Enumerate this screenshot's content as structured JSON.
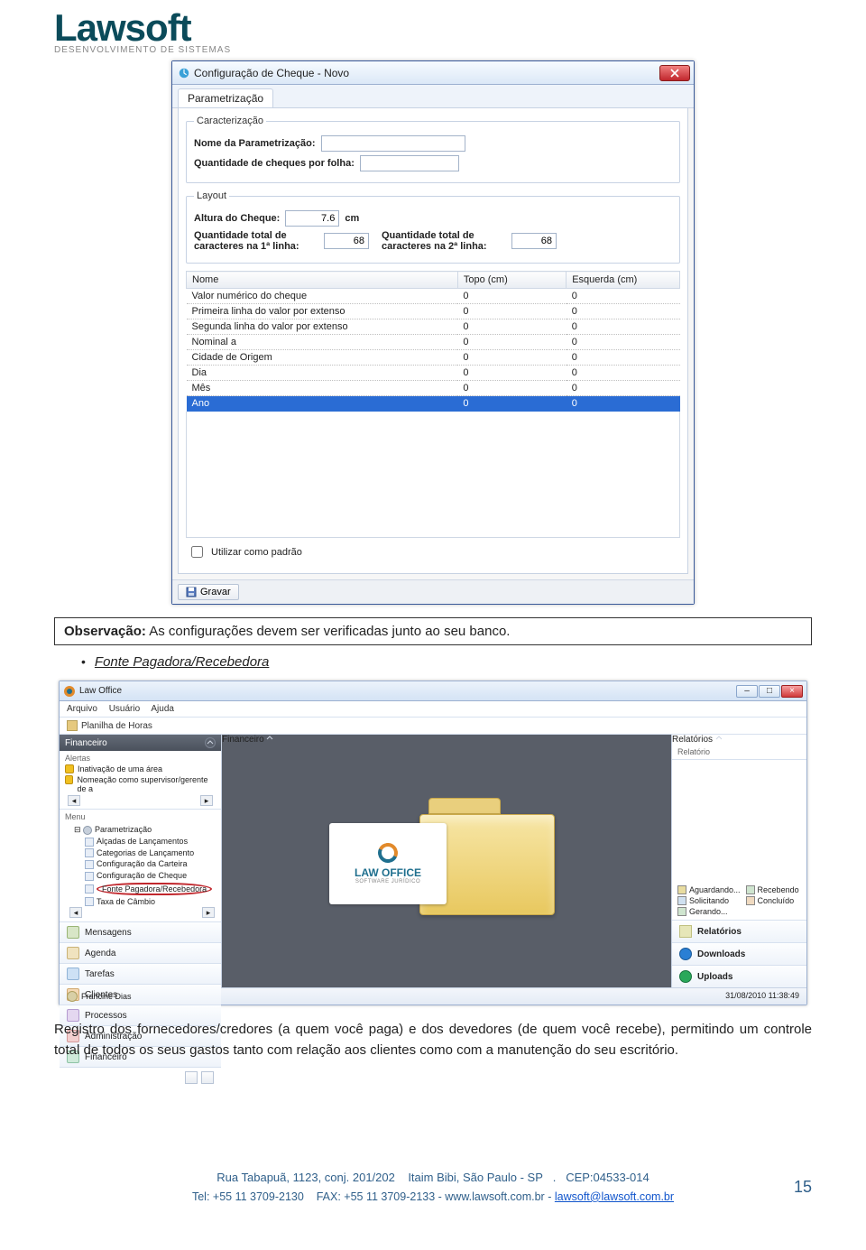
{
  "brand": {
    "name": "Lawsoft",
    "tagline": "DESENVOLVIMENTO DE SISTEMAS"
  },
  "cheque_window": {
    "title": "Configuração de Cheque - Novo",
    "tab": "Parametrização",
    "group1": {
      "legend": "Caracterização",
      "nome_label": "Nome da Parametrização:",
      "nome_value": "",
      "qtd_folha_label": "Quantidade de cheques por folha:",
      "qtd_folha_value": ""
    },
    "group2": {
      "legend": "Layout",
      "altura_label": "Altura do Cheque:",
      "altura_value": "7.6",
      "altura_unit": "cm",
      "qtd1_label": "Quantidade total de caracteres na 1ª linha:",
      "qtd1_value": "68",
      "qtd2_label": "Quantidade total de caracteres na 2ª linha:",
      "qtd2_value": "68"
    },
    "table": {
      "cols": [
        "Nome",
        "Topo (cm)",
        "Esquerda (cm)"
      ],
      "rows": [
        {
          "n": "Valor numérico do cheque",
          "t": "0",
          "e": "0"
        },
        {
          "n": "Primeira linha do valor por extenso",
          "t": "0",
          "e": "0"
        },
        {
          "n": "Segunda linha do valor por extenso",
          "t": "0",
          "e": "0"
        },
        {
          "n": "Nominal a",
          "t": "0",
          "e": "0"
        },
        {
          "n": "Cidade de Origem",
          "t": "0",
          "e": "0"
        },
        {
          "n": "Dia",
          "t": "0",
          "e": "0"
        },
        {
          "n": "Mês",
          "t": "0",
          "e": "0"
        },
        {
          "n": "Ano",
          "t": "0",
          "e": "0",
          "selected": true
        }
      ]
    },
    "default_label": "Utilizar como padrão",
    "save_label": "Gravar"
  },
  "note": {
    "prefix": "Observação:",
    "text": " As configurações devem ser verificadas junto ao seu banco."
  },
  "bullet": {
    "text": "Fonte Pagadora/Recebedora"
  },
  "lawoffice": {
    "title": "Law Office",
    "menus": [
      "Arquivo",
      "Usuário",
      "Ajuda"
    ],
    "subbar": "Planilha de Horas",
    "left_panel": {
      "title": "Financeiro"
    },
    "alerts": {
      "head": "Alertas",
      "items": [
        "Inativação de uma área",
        "Nomeação como supervisor/gerente de a"
      ]
    },
    "menu_head": "Menu",
    "tree": {
      "root": "Parametrização",
      "items": [
        "Alçadas de Lançamentos",
        "Categorias de Lançamento",
        "Configuração da Carteira",
        "Configuração de Cheque",
        "Fonte Pagadora/Recebedora",
        "Taxa de Câmbio"
      ]
    },
    "sidenav": [
      "Mensagens",
      "Agenda",
      "Tarefas",
      "Clientes",
      "Processos",
      "Administração",
      "Financeiro"
    ],
    "logo": {
      "l1": "LAW OFFICE",
      "l2": "SOFTWARE JURÍDICO"
    },
    "right_panel_title": "Relatórios",
    "right_panel_sub": "Relatório",
    "center_panel_title": "Financeiro",
    "statuses": [
      "Aguardando...",
      "Recebendo",
      "Solicitando",
      "Concluído",
      "Gerando..."
    ],
    "right_items": [
      "Relatórios",
      "Downloads",
      "Uploads"
    ],
    "user": "Francine Dias",
    "timestamp": "31/08/2010 11:38:49"
  },
  "paragraph": "Registro dos fornecedores/credores (a quem você paga) e dos devedores (de quem você recebe), permitindo um controle total de todos os seus gastos tanto com relação aos clientes como com a manutenção do seu escritório.",
  "footer": {
    "line1a": "Rua Tabapuã, 1123, conj. 201/202",
    "line1b": "Itaim Bibi, São Paulo - SP",
    "line1c": ".",
    "line1d": "CEP:04533-014",
    "line2a": "Tel: +55 11 3709-2130",
    "line2b": "FAX: +55 11 3709-2133 - www.lawsoft.com.br -",
    "email": "lawsoft@lawsoft.com.br",
    "page": "15"
  }
}
